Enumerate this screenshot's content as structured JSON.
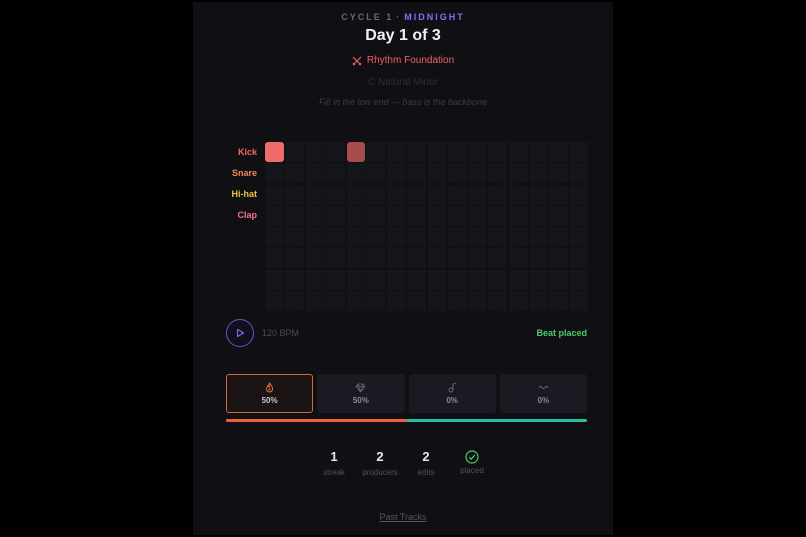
{
  "header": {
    "cycle_label": "CYCLE 1",
    "separator": "·",
    "theme": "MIDNIGHT",
    "title": "Day 1 of 3",
    "mission": "Rhythm Foundation",
    "key": "C Natural Minor",
    "hint": "Fill in the low end — bass is the backbone"
  },
  "sequencer": {
    "steps": 16,
    "rows": [
      {
        "label": "Kick",
        "color": "#f06a5a",
        "active_steps": [
          1,
          5
        ],
        "dim_steps": [
          5
        ]
      },
      {
        "label": "Snare",
        "color": "#f0885a",
        "active_steps": [],
        "dim_steps": []
      },
      {
        "label": "Hi-hat",
        "color": "#f0c440",
        "active_steps": [],
        "dim_steps": []
      },
      {
        "label": "Clap",
        "color": "#f07090",
        "active_steps": [],
        "dim_steps": []
      },
      {
        "label": "",
        "color": "#000000",
        "active_steps": [],
        "dim_steps": []
      },
      {
        "label": "",
        "color": "#000000",
        "active_steps": [],
        "dim_steps": []
      },
      {
        "label": "",
        "color": "#000000",
        "active_steps": [],
        "dim_steps": []
      },
      {
        "label": "",
        "color": "#000000",
        "active_steps": [],
        "dim_steps": []
      }
    ]
  },
  "transport": {
    "bpm": "120 BPM",
    "status": "Beat placed"
  },
  "stats": [
    {
      "icon": "flame-icon",
      "value": "50%",
      "active": true
    },
    {
      "icon": "gem-icon",
      "value": "50%",
      "active": false
    },
    {
      "icon": "music-note-icon",
      "value": "0%",
      "active": false
    },
    {
      "icon": "wave-icon",
      "value": "0%",
      "active": false
    }
  ],
  "progress_fraction": 0.5,
  "counters": [
    {
      "value": "1",
      "label": "streak"
    },
    {
      "value": "2",
      "label": "producers"
    },
    {
      "value": "2",
      "label": "edits"
    },
    {
      "value": "",
      "label": "placed",
      "icon": "check-circle-icon"
    }
  ],
  "footer": {
    "past_tracks": "Past Tracks"
  }
}
